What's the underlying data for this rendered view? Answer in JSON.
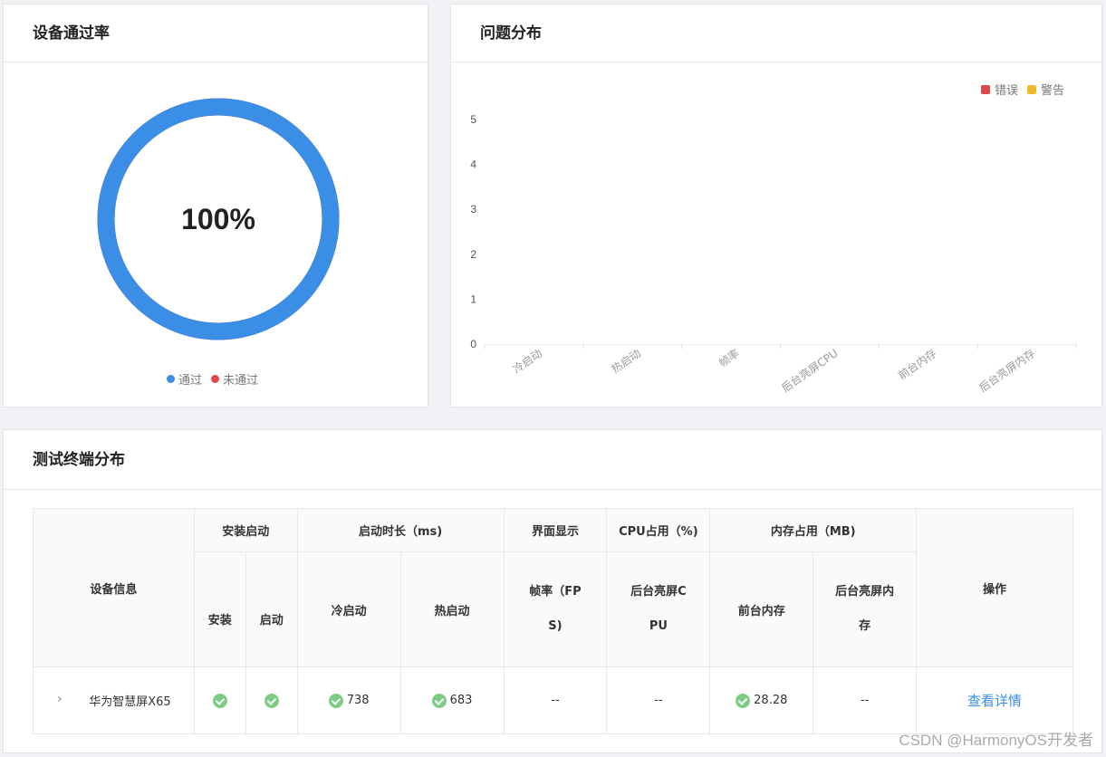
{
  "pass_card": {
    "title": "设备通过率",
    "percent_text": "100%",
    "pass_ratio": 1.0,
    "legend": [
      {
        "label": "通过",
        "color": "#3a8ee6"
      },
      {
        "label": "未通过",
        "color": "#e04848"
      }
    ]
  },
  "issue_card": {
    "title": "问题分布",
    "legend": [
      {
        "label": "错误",
        "color": "#e04848"
      },
      {
        "label": "警告",
        "color": "#f0b92c"
      }
    ]
  },
  "chart_data": {
    "type": "bar",
    "categories": [
      "冷启动",
      "热启动",
      "帧率",
      "后台亮屏CPU",
      "前台内存",
      "后台亮屏内存"
    ],
    "series": [
      {
        "name": "错误",
        "values": [
          0,
          0,
          0,
          0,
          0,
          0
        ]
      },
      {
        "name": "警告",
        "values": [
          0,
          0,
          0,
          0,
          0,
          0
        ]
      }
    ],
    "yticks": [
      "0",
      "1",
      "2",
      "3",
      "4",
      "5"
    ],
    "ylim": [
      0,
      5
    ],
    "legend_position": "top-right",
    "grid": false
  },
  "terminal_card": {
    "title": "测试终端分布",
    "headers": {
      "device_info": "设备信息",
      "install_launch": "安装启动",
      "install": "安装",
      "launch": "启动",
      "launch_duration": "启动时长（ms)",
      "cold_start": "冷启动",
      "hot_start": "热启动",
      "ui_display": "界面显示",
      "fps_line1": "帧率（FP",
      "fps_line2": "S)",
      "cpu_usage": "CPU占用（%)",
      "bg_cpu_line1": "后台亮屏C",
      "bg_cpu_line2": "PU",
      "memory_usage": "内存占用（MB)",
      "fg_memory": "前台内存",
      "bg_mem_line1": "后台亮屏内",
      "bg_mem_line2": "存",
      "actions": "操作"
    },
    "rows": [
      {
        "expand_icon": "›",
        "device": "华为智慧屏X65",
        "cold_start": "738",
        "hot_start": "683",
        "fps": "--",
        "bg_cpu": "--",
        "fg_memory": "28.28",
        "bg_memory": "--",
        "action": "查看详情"
      }
    ]
  },
  "watermark": "CSDN @HarmonyOS开发者"
}
